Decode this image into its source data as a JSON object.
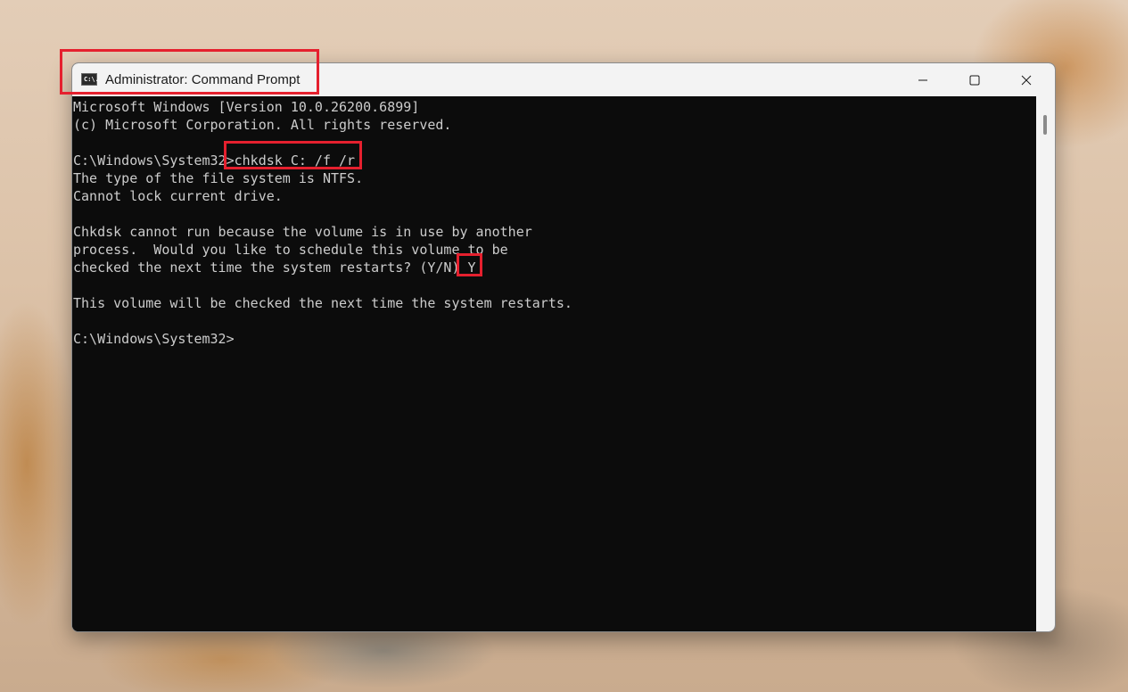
{
  "window": {
    "title": "Administrator: Command Prompt",
    "icon": "cmd-app-icon",
    "icon_glyph": "C:\\.",
    "controls": {
      "minimize_icon": "minimize-icon",
      "maximize_icon": "maximize-icon",
      "close_icon": "close-icon"
    }
  },
  "terminal": {
    "lines": [
      "Microsoft Windows [Version 10.0.26200.6899]",
      "(c) Microsoft Corporation. All rights reserved.",
      "",
      "C:\\Windows\\System32>chkdsk C: /f /r",
      "The type of the file system is NTFS.",
      "Cannot lock current drive.",
      "",
      "Chkdsk cannot run because the volume is in use by another",
      "process.  Would you like to schedule this volume to be",
      "checked the next time the system restarts? (Y/N) Y",
      "",
      "This volume will be checked the next time the system restarts.",
      "",
      "C:\\Windows\\System32>"
    ],
    "colors": {
      "background": "#0c0c0c",
      "text": "#cccccc"
    }
  },
  "highlights": {
    "color": "#e5202e",
    "items": [
      "title-bar",
      "chkdsk-command",
      "answer-y"
    ]
  }
}
